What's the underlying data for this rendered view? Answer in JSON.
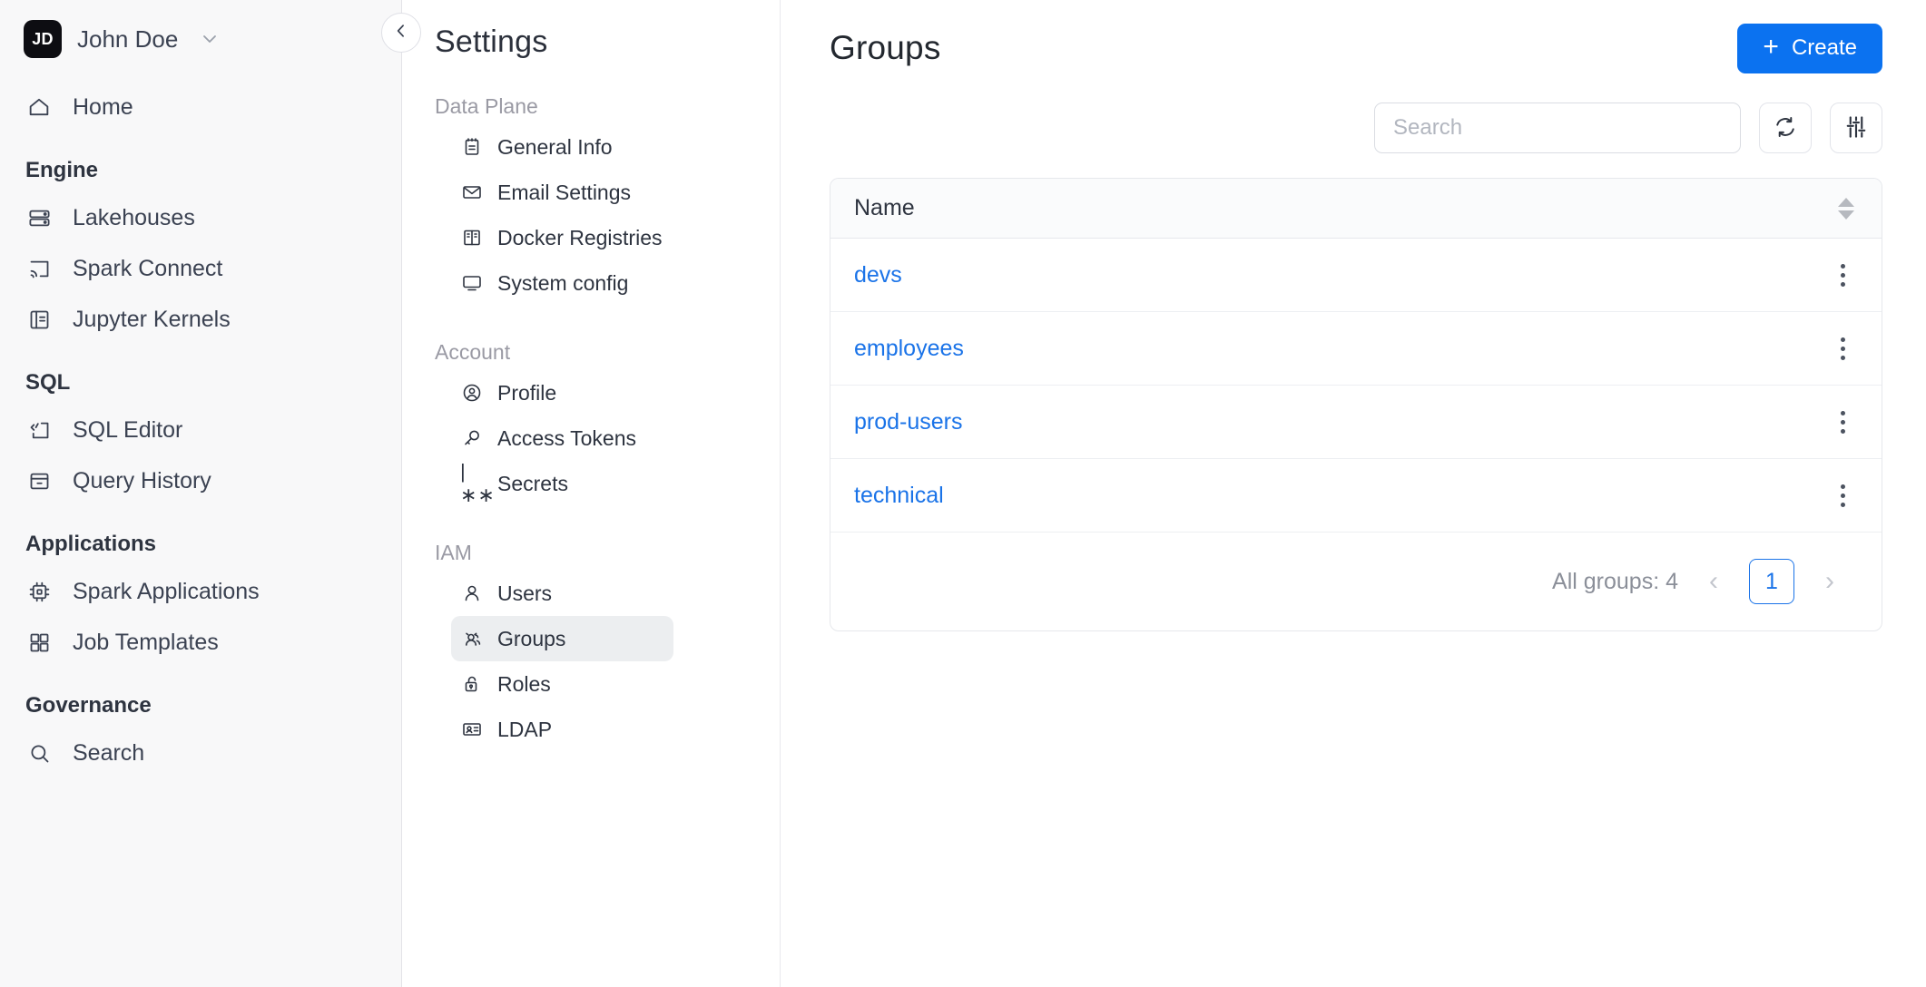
{
  "leftnav": {
    "user": {
      "initials": "JD",
      "name": "John Doe",
      "caret_icon": "chevron-down-icon"
    },
    "home": {
      "label": "Home",
      "icon": "home-icon"
    },
    "sections": [
      {
        "title": "Engine",
        "items": [
          {
            "label": "Lakehouses",
            "icon": "server-icon"
          },
          {
            "label": "Spark Connect",
            "icon": "cast-icon"
          },
          {
            "label": "Jupyter Kernels",
            "icon": "notebook-icon"
          }
        ]
      },
      {
        "title": "SQL",
        "items": [
          {
            "label": "SQL Editor",
            "icon": "code-icon"
          },
          {
            "label": "Query History",
            "icon": "archive-icon"
          }
        ]
      },
      {
        "title": "Applications",
        "items": [
          {
            "label": "Spark Applications",
            "icon": "cpu-icon"
          },
          {
            "label": "Job Templates",
            "icon": "grid-icon"
          }
        ]
      },
      {
        "title": "Governance",
        "items": [
          {
            "label": "Search",
            "icon": "search-icon"
          }
        ]
      }
    ]
  },
  "settings": {
    "title": "Settings",
    "collapse_icon": "chevron-left-icon",
    "groups": [
      {
        "title": "Data Plane",
        "items": [
          {
            "label": "General Info",
            "icon": "clipboard-icon",
            "active": false
          },
          {
            "label": "Email Settings",
            "icon": "mail-icon",
            "active": false
          },
          {
            "label": "Docker Registries",
            "icon": "registry-icon",
            "active": false
          },
          {
            "label": "System config",
            "icon": "monitor-icon",
            "active": false
          }
        ]
      },
      {
        "title": "Account",
        "items": [
          {
            "label": "Profile",
            "icon": "user-circle-icon",
            "active": false
          },
          {
            "label": "Access Tokens",
            "icon": "key-icon",
            "active": false
          },
          {
            "label": "Secrets",
            "icon": "secrets-glyph-icon",
            "glyph": "|∗∗",
            "active": false
          }
        ]
      },
      {
        "title": "IAM",
        "items": [
          {
            "label": "Users",
            "icon": "user-icon",
            "active": false
          },
          {
            "label": "Groups",
            "icon": "users-icon",
            "active": true
          },
          {
            "label": "Roles",
            "icon": "lock-open-icon",
            "active": false
          },
          {
            "label": "LDAP",
            "icon": "id-card-icon",
            "active": false
          }
        ]
      }
    ]
  },
  "main": {
    "page_title": "Groups",
    "create_button": {
      "label": "Create",
      "plus": "+",
      "icon": "plus-icon",
      "color": "#0b72f0"
    },
    "search": {
      "value": "",
      "placeholder": "Search"
    },
    "refresh_button": {
      "icon": "refresh-icon"
    },
    "filter_button": {
      "icon": "sliders-icon"
    },
    "table": {
      "columns": [
        "Name"
      ],
      "sort_icon": "sort-arrows-icon",
      "rows": [
        {
          "name": "devs",
          "menu_icon": "kebab-menu-icon"
        },
        {
          "name": "employees",
          "menu_icon": "kebab-menu-icon"
        },
        {
          "name": "prod-users",
          "menu_icon": "kebab-menu-icon"
        },
        {
          "name": "technical",
          "menu_icon": "kebab-menu-icon"
        }
      ],
      "link_color": "#1a73e8"
    },
    "pagination": {
      "total_label": "All groups: 4",
      "prev": "‹",
      "current_page": "1",
      "next": "›"
    }
  }
}
